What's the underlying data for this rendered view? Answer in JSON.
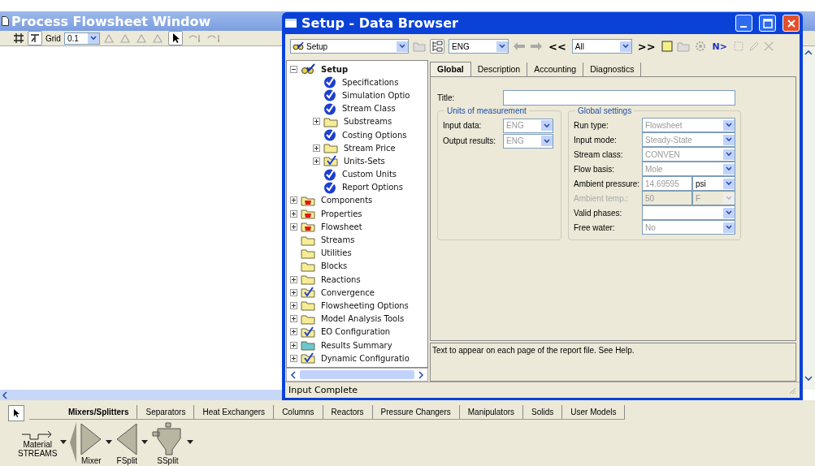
{
  "flowsheet_window": {
    "title": "Process Flowsheet Window",
    "toolbar": {
      "grid_label": "Grid",
      "grid_value": "0.1"
    }
  },
  "data_browser": {
    "title": "Setup - Data Browser",
    "toolbar": {
      "form_select": "Setup",
      "units_select": "ENG",
      "prev_button": "<<",
      "filter_select": "All",
      "next_button": ">>",
      "next_input_button": "N>"
    },
    "tree": [
      {
        "label": "Setup",
        "kind": "setup",
        "expanded": true,
        "selected": true,
        "children": [
          {
            "label": "Specifications",
            "kind": "check",
            "selected": false
          },
          {
            "label": "Simulation Optio",
            "kind": "check",
            "selected": false
          },
          {
            "label": "Stream Class",
            "kind": "check",
            "selected": false
          },
          {
            "label": "Substreams",
            "kind": "folder",
            "expanded": false,
            "selected": false
          },
          {
            "label": "Costing Options",
            "kind": "check",
            "selected": false
          },
          {
            "label": "Stream Price",
            "kind": "folder",
            "expanded": false,
            "selected": false
          },
          {
            "label": "Units-Sets",
            "kind": "folder-check",
            "expanded": false,
            "selected": false
          },
          {
            "label": "Custom Units",
            "kind": "check",
            "selected": false
          },
          {
            "label": "Report Options",
            "kind": "check",
            "selected": false
          }
        ]
      },
      {
        "label": "Components",
        "kind": "folder-red",
        "expanded": false,
        "selected": false
      },
      {
        "label": "Properties",
        "kind": "folder-red",
        "expanded": false,
        "selected": false
      },
      {
        "label": "Flowsheet",
        "kind": "folder-red",
        "expanded": false,
        "selected": false
      },
      {
        "label": "Streams",
        "kind": "folder",
        "selected": false
      },
      {
        "label": "Utilities",
        "kind": "folder",
        "selected": false
      },
      {
        "label": "Blocks",
        "kind": "folder",
        "selected": false
      },
      {
        "label": "Reactions",
        "kind": "folder",
        "expanded": false,
        "selected": false
      },
      {
        "label": "Convergence",
        "kind": "folder-check",
        "expanded": false,
        "selected": false
      },
      {
        "label": "Flowsheeting Options",
        "kind": "folder",
        "expanded": false,
        "selected": false
      },
      {
        "label": "Model Analysis Tools",
        "kind": "folder",
        "expanded": false,
        "selected": false
      },
      {
        "label": "EO Configuration",
        "kind": "folder-check",
        "expanded": false,
        "selected": false
      },
      {
        "label": "Results Summary",
        "kind": "folder-teal",
        "expanded": false,
        "selected": false
      },
      {
        "label": "Dynamic Configuratio",
        "kind": "folder-check",
        "expanded": false,
        "selected": false
      }
    ],
    "tabs": [
      {
        "label": "Global",
        "selected": true
      },
      {
        "label": "Description",
        "selected": false
      },
      {
        "label": "Accounting",
        "selected": false
      },
      {
        "label": "Diagnostics",
        "selected": false
      }
    ],
    "form": {
      "title_label": "Title:",
      "units_group": {
        "title": "Units of measurement",
        "rows": [
          {
            "label": "Input data:",
            "value": "ENG"
          },
          {
            "label": "Output results:",
            "value": "ENG"
          }
        ]
      },
      "settings_group": {
        "title": "Global settings",
        "rows": [
          {
            "label": "Run type:",
            "value": "Flowsheet",
            "disabled": false
          },
          {
            "label": "Input mode:",
            "value": "Steady-State",
            "disabled": false
          },
          {
            "label": "Stream class:",
            "value": "CONVEN",
            "disabled": false
          },
          {
            "label": "Flow basis:",
            "value": "Mole",
            "disabled": false
          },
          {
            "label": "Ambient pressure:",
            "value": "14.69595",
            "unit": "psi",
            "disabled": false
          },
          {
            "label": "Ambient temp.:",
            "value": "50",
            "unit": "F",
            "disabled": true
          },
          {
            "label": "Valid phases:",
            "disabled": false
          },
          {
            "label": "Free water:",
            "value": "No",
            "disabled": false
          }
        ]
      }
    },
    "help_text": "Text to appear on each page of the report file. See Help.",
    "status": "Input Complete"
  },
  "model_library": {
    "tabs": [
      {
        "label": "Mixers/Splitters",
        "selected": true
      },
      {
        "label": "Separators",
        "selected": false
      },
      {
        "label": "Heat Exchangers",
        "selected": false
      },
      {
        "label": "Columns",
        "selected": false
      },
      {
        "label": "Reactors",
        "selected": false
      },
      {
        "label": "Pressure Changers",
        "selected": false
      },
      {
        "label": "Manipulators",
        "selected": false
      },
      {
        "label": "Solids",
        "selected": false
      },
      {
        "label": "User Models",
        "selected": false
      }
    ],
    "streams": {
      "label": "Material",
      "type": "STREAMS"
    },
    "models": [
      {
        "label": "Mixer",
        "kind": "mixer"
      },
      {
        "label": "FSplit",
        "kind": "fsplit"
      },
      {
        "label": "SSplit",
        "kind": "ssplit"
      }
    ]
  }
}
